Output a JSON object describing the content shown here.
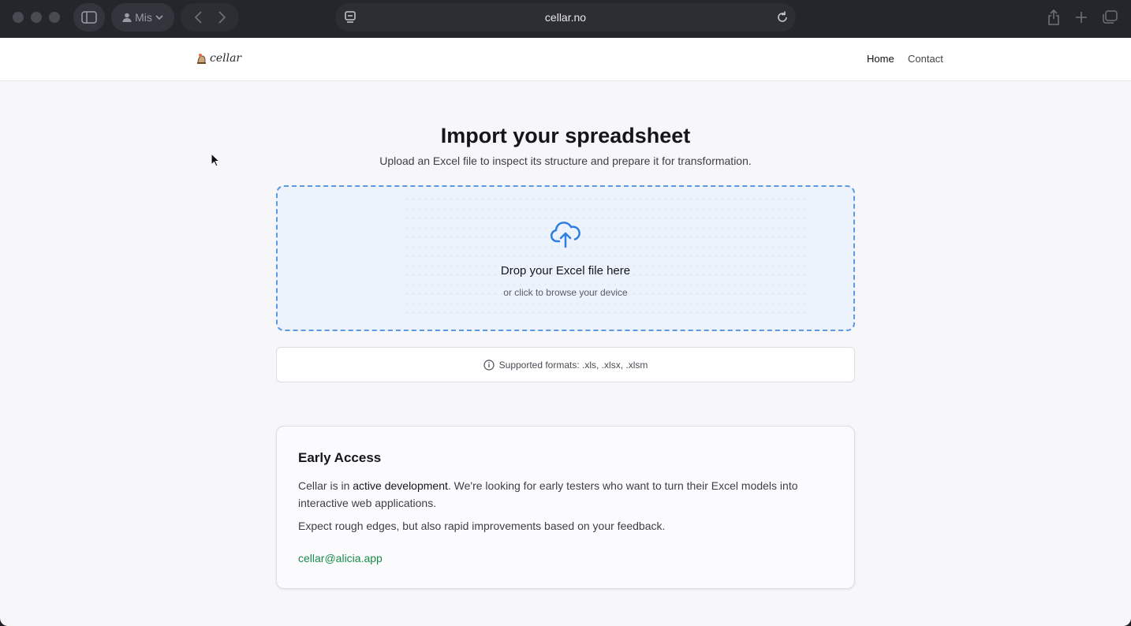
{
  "browser": {
    "profile_label": "Mis",
    "url": "cellar.no"
  },
  "site": {
    "logo_text": "cellar",
    "nav": {
      "home": "Home",
      "contact": "Contact"
    }
  },
  "main": {
    "title": "Import your spreadsheet",
    "subtitle": "Upload an Excel file to inspect its structure and prepare it for transformation.",
    "dropzone": {
      "title": "Drop your Excel file here",
      "subtitle": "or click to browse your device"
    },
    "formats": "Supported formats: .xls, .xlsx, .xlsm"
  },
  "early_access": {
    "title": "Early Access",
    "p1_before": "Cellar is in ",
    "p1_emphasis": "active development",
    "p1_after": ". We're looking for early testers who want to turn their Excel models into interactive web applications.",
    "p2": "Expect rough edges, but also rapid improvements based on your feedback.",
    "email": "cellar@alicia.app"
  },
  "colors": {
    "accent_blue": "#2f7fe0",
    "email_green": "#1a8a4a"
  }
}
